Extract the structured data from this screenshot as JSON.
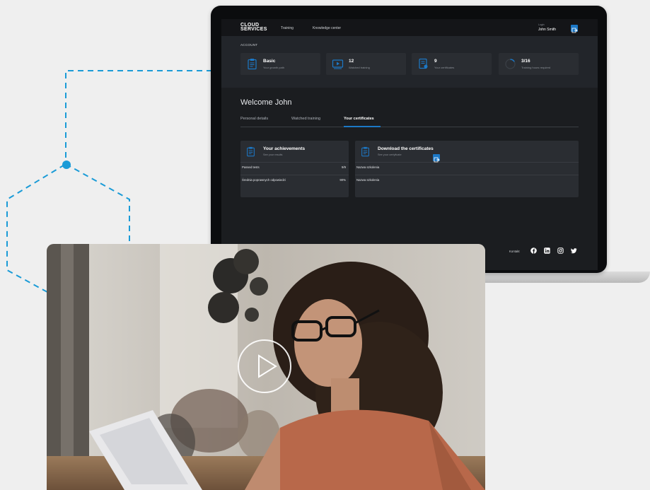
{
  "laptop": {
    "brand_line1": "CLOUD",
    "brand_line2": "SERVICES",
    "nav": [
      "Training",
      "Knowledge center"
    ],
    "login_label": "Login",
    "user_name": "John Smith",
    "account_label": "ACCOUNT",
    "stats": [
      {
        "value": "Basic",
        "label": "Your growth path",
        "icon": "clipboard-icon"
      },
      {
        "value": "12",
        "label": "Watched training",
        "icon": "video-icon"
      },
      {
        "value": "9",
        "label": "Your certificates",
        "icon": "certificate-icon"
      },
      {
        "value": "3/16",
        "label": "Training hours required",
        "icon": "progress-clock-icon"
      }
    ],
    "welcome": "Welcome John",
    "tabs": [
      "Personal details",
      "Watched training",
      "Your certificates"
    ],
    "active_tab": "Your certificates",
    "achievements": {
      "title": "Your achievements",
      "subtitle": "See your results",
      "rows": [
        {
          "label": "Passed tests",
          "value": "9/9"
        },
        {
          "label": "Średnia poprawnych odpowiedzi",
          "value": "90%"
        }
      ]
    },
    "certificates": {
      "title": "Download the certificates",
      "subtitle": "See your certyficate",
      "rows": [
        "Nazwa szkolenia",
        "Nazwa szkolenia"
      ]
    },
    "footer_contact": "Kontakt",
    "social": [
      "facebook-icon",
      "linkedin-icon",
      "instagram-icon",
      "twitter-icon"
    ]
  },
  "colors": {
    "accent": "#1c78c6",
    "deco_line": "#1a9bd7",
    "screen_bg": "#1b1d20",
    "card_bg": "#2a2d32"
  }
}
